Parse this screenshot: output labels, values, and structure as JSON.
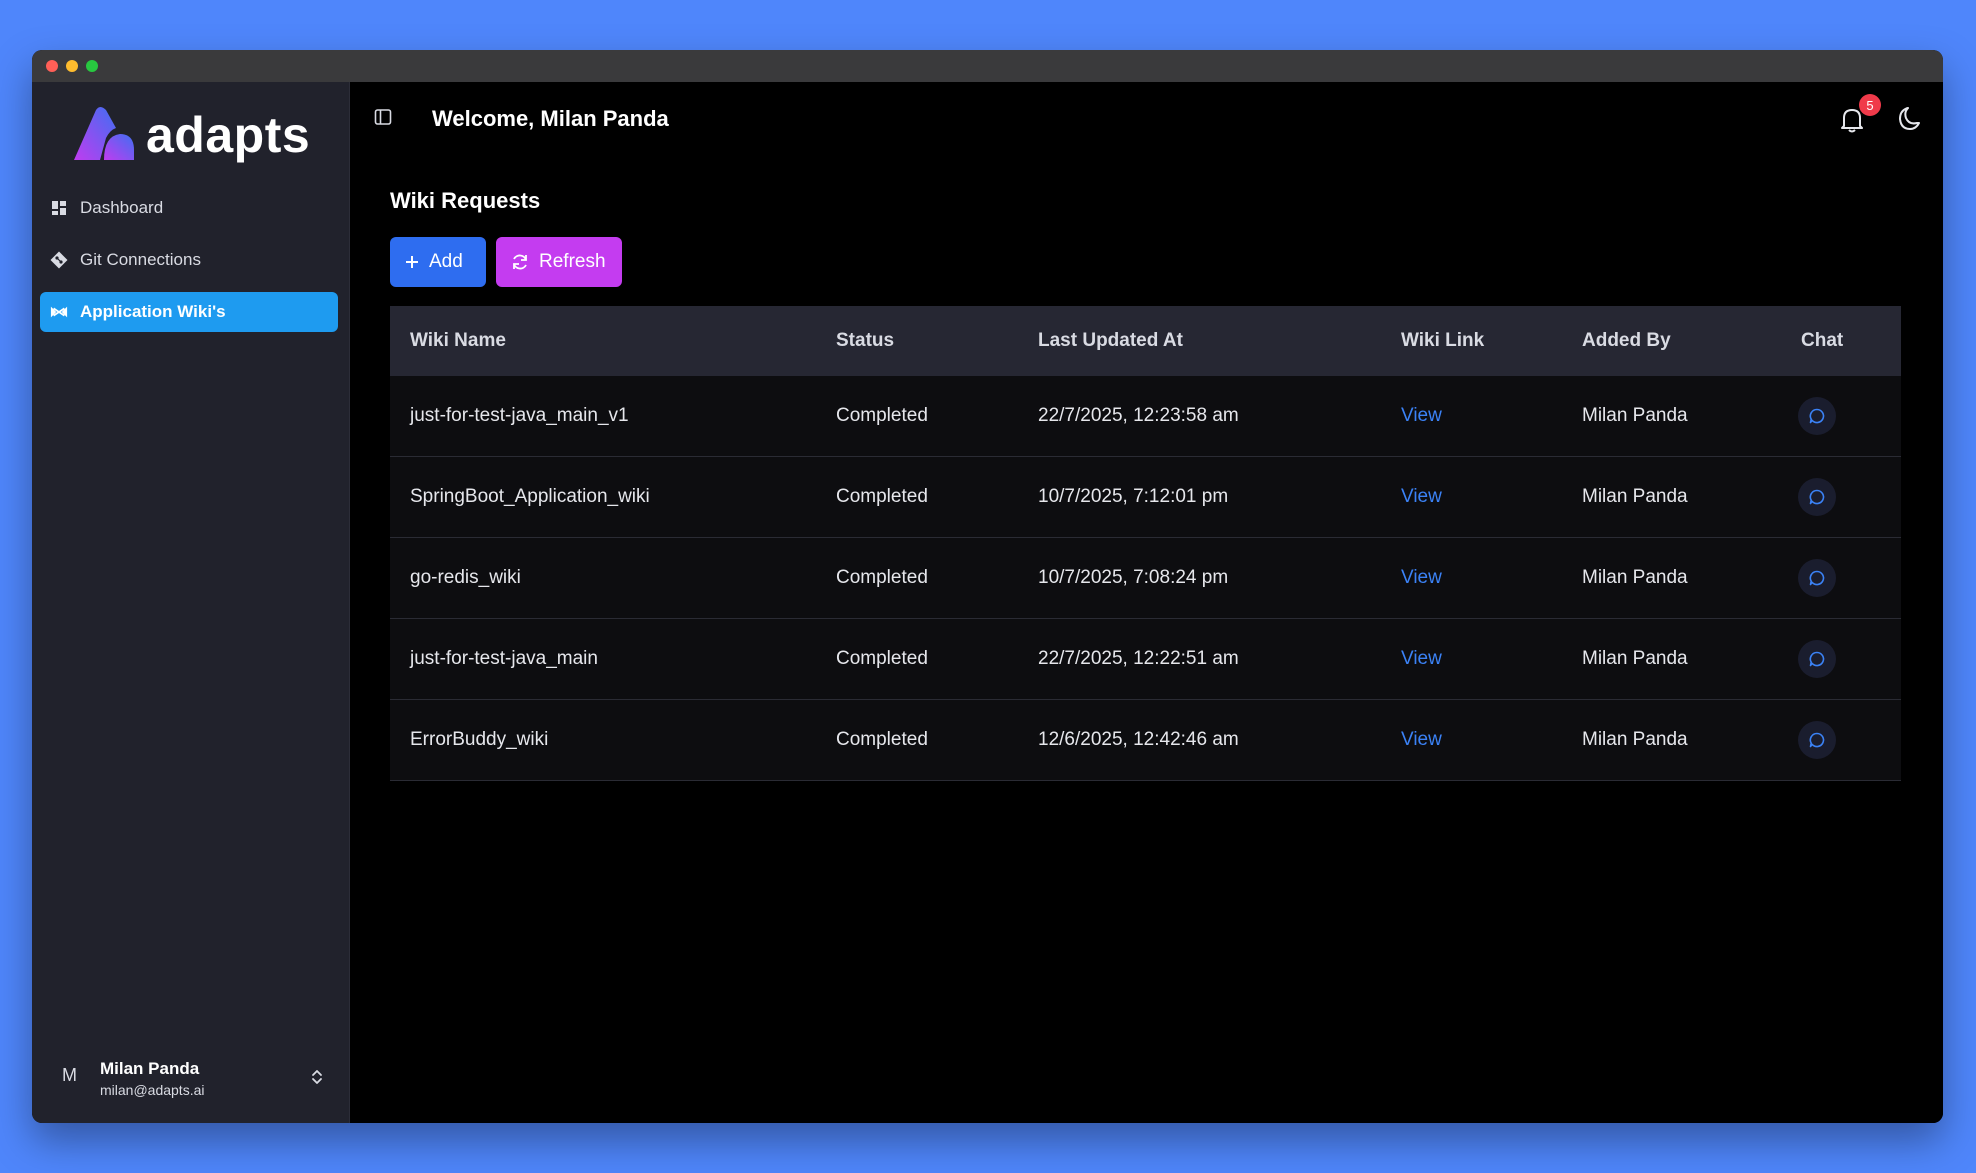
{
  "brand": {
    "name": "adapts"
  },
  "sidebar": {
    "items": [
      {
        "label": "Dashboard",
        "icon": "dashboard-icon"
      },
      {
        "label": "Git Connections",
        "icon": "git-icon"
      },
      {
        "label": "Application Wiki's",
        "icon": "wiki-icon",
        "active": true
      }
    ],
    "user": {
      "initial": "M",
      "name": "Milan Panda",
      "email": "milan@adapts.ai"
    }
  },
  "header": {
    "welcome": "Welcome, Milan Panda",
    "notification_count": "5"
  },
  "page": {
    "title": "Wiki Requests",
    "add_label": "Add",
    "refresh_label": "Refresh"
  },
  "table": {
    "columns": [
      "Wiki Name",
      "Status",
      "Last Updated At",
      "Wiki Link",
      "Added By",
      "Chat"
    ],
    "rows": [
      {
        "name": "just-for-test-java_main_v1",
        "status": "Completed",
        "updated": "22/7/2025, 12:23:58 am",
        "link": "View",
        "added_by": "Milan Panda"
      },
      {
        "name": "SpringBoot_Application_wiki",
        "status": "Completed",
        "updated": "10/7/2025, 7:12:01 pm",
        "link": "View",
        "added_by": "Milan Panda"
      },
      {
        "name": "go-redis_wiki",
        "status": "Completed",
        "updated": "10/7/2025, 7:08:24 pm",
        "link": "View",
        "added_by": "Milan Panda"
      },
      {
        "name": "just-for-test-java_main",
        "status": "Completed",
        "updated": "22/7/2025, 12:22:51 am",
        "link": "View",
        "added_by": "Milan Panda"
      },
      {
        "name": "ErrorBuddy_wiki",
        "status": "Completed",
        "updated": "12/6/2025, 12:42:46 am",
        "link": "View",
        "added_by": "Milan Panda"
      }
    ]
  },
  "colors": {
    "background": "#4f86fb",
    "active_nav": "#1e9bf0",
    "add_button": "#2e6df0",
    "refresh_button": "#c43cf0",
    "link": "#3b82f6",
    "badge": "#f03a4a"
  }
}
